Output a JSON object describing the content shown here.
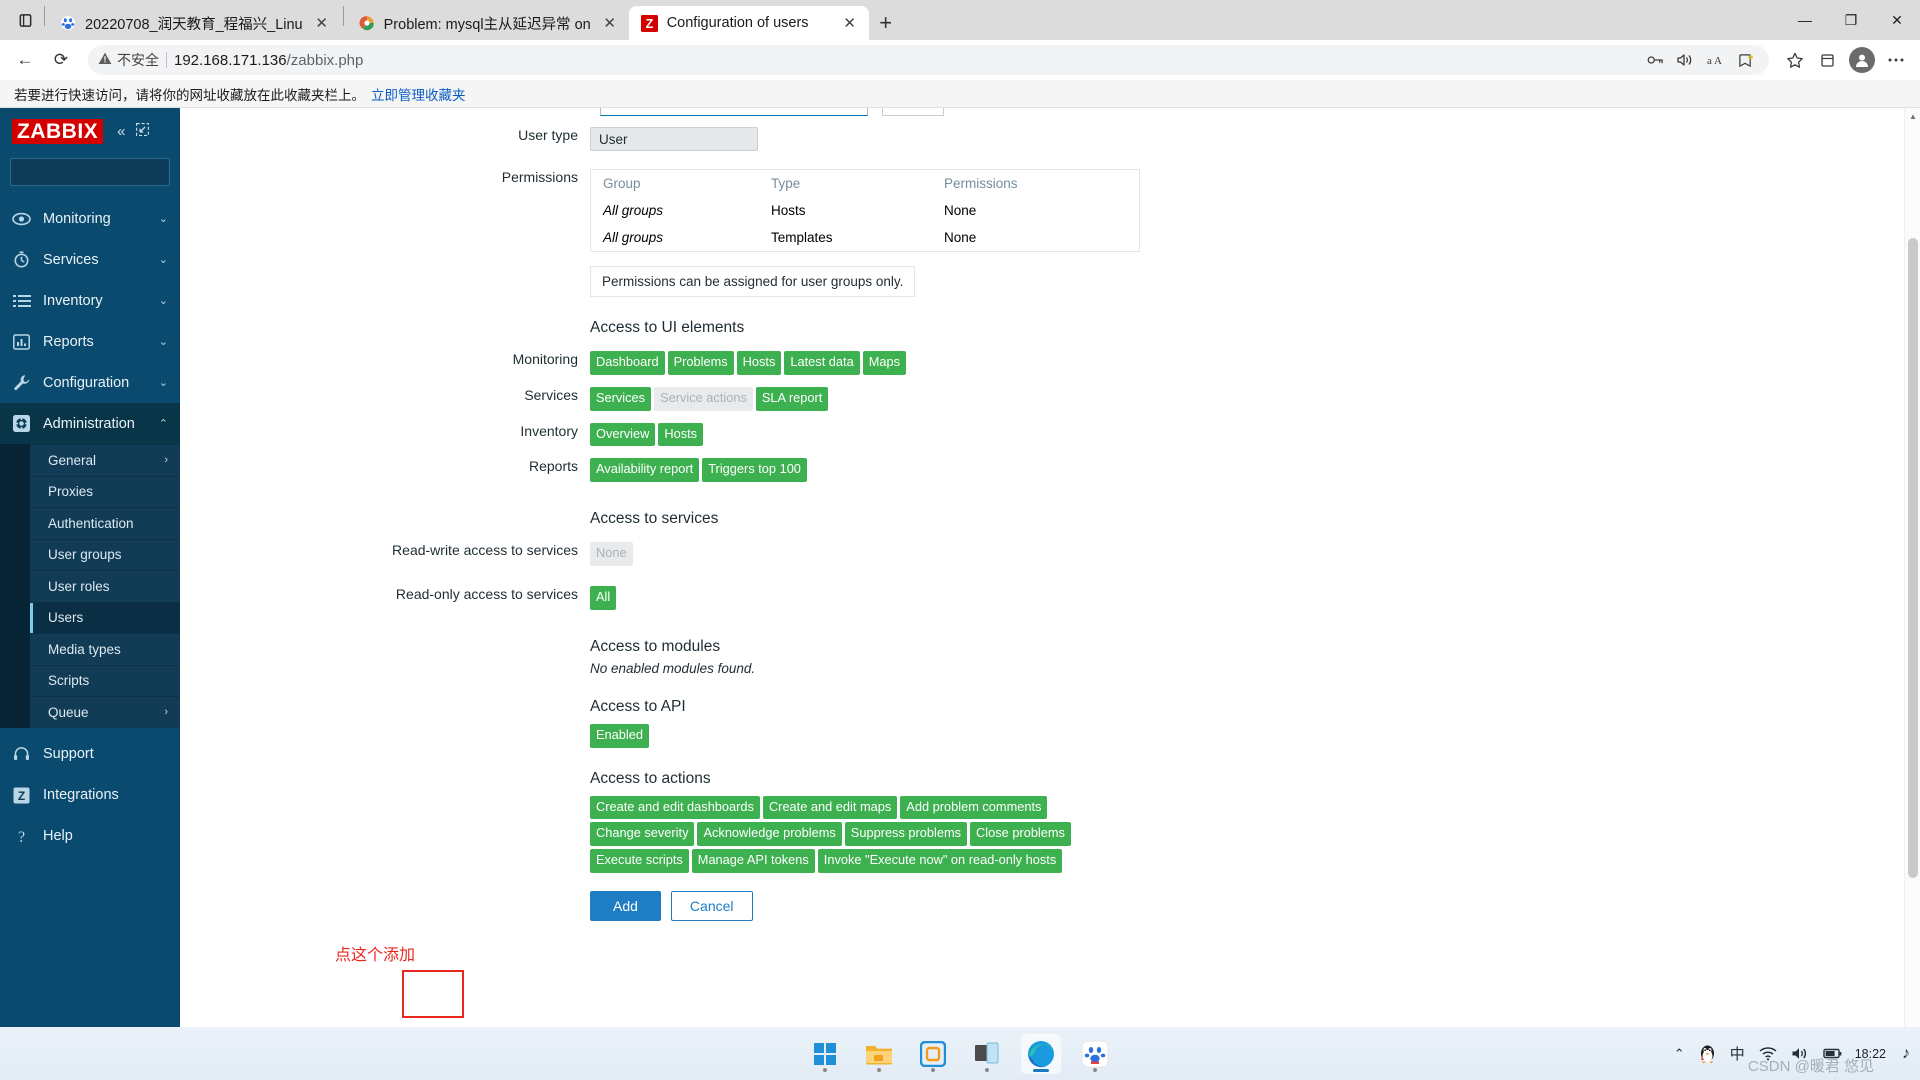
{
  "browser": {
    "tabs": [
      {
        "title": "20220708_润天教育_程福兴_Linu",
        "favicon": "baidu-icon",
        "active": false,
        "close_label": "✕"
      },
      {
        "title": "Problem: mysql主从延迟异常 on",
        "favicon": "zabbix-problem-icon",
        "active": false,
        "close_label": "✕"
      },
      {
        "title": "Configuration of users",
        "favicon": "zabbix-icon",
        "active": true,
        "close_label": "✕"
      }
    ],
    "new_tab_label": "+",
    "window_controls": {
      "minimize": "—",
      "maximize": "❐",
      "close": "✕"
    },
    "nav": {
      "back": "←",
      "reload": "⟳"
    },
    "omnibox": {
      "security_label": "不安全",
      "url_host": "192.168.171.136",
      "url_path": "/zabbix.php",
      "icons": [
        "key-icon",
        "read-aloud-icon",
        "translate-icon",
        "collections-add-icon"
      ]
    },
    "nav_right": {
      "favorites": "favorites-icon",
      "collections": "collections-icon",
      "profile": "avatar-icon",
      "settings": "more-settings-icon"
    },
    "bookmark_bar": {
      "text": "若要进行快速访问，请将你的网址收藏放在此收藏夹栏上。",
      "link": "立即管理收藏夹"
    }
  },
  "sidebar": {
    "logo": "ZABBIX",
    "collapse_icon": "«",
    "expand_icon": "⇱",
    "search_placeholder": "",
    "search_value": "",
    "items": [
      {
        "label": "Monitoring",
        "icon": "eye-icon",
        "chevron": "⌄",
        "active": false
      },
      {
        "label": "Services",
        "icon": "stopwatch-icon",
        "chevron": "⌄",
        "active": false
      },
      {
        "label": "Inventory",
        "icon": "list-icon",
        "chevron": "⌄",
        "active": false
      },
      {
        "label": "Reports",
        "icon": "bar-chart-icon",
        "chevron": "⌄",
        "active": false
      },
      {
        "label": "Configuration",
        "icon": "wrench-icon",
        "chevron": "⌄",
        "active": false
      },
      {
        "label": "Administration",
        "icon": "gear-icon",
        "chevron": "⌃",
        "active": true
      }
    ],
    "submenu": [
      {
        "label": "General",
        "arrow": "›",
        "selected": false
      },
      {
        "label": "Proxies",
        "arrow": "",
        "selected": false
      },
      {
        "label": "Authentication",
        "arrow": "",
        "selected": false
      },
      {
        "label": "User groups",
        "arrow": "",
        "selected": false
      },
      {
        "label": "User roles",
        "arrow": "",
        "selected": false
      },
      {
        "label": "Users",
        "arrow": "",
        "selected": true
      },
      {
        "label": "Media types",
        "arrow": "",
        "selected": false
      },
      {
        "label": "Scripts",
        "arrow": "",
        "selected": false
      },
      {
        "label": "Queue",
        "arrow": "›",
        "selected": false
      }
    ],
    "bottom_items": [
      {
        "label": "Support",
        "icon": "headset-icon"
      },
      {
        "label": "Integrations",
        "icon": "zabbix-z-icon"
      },
      {
        "label": "Help",
        "icon": "question-icon"
      }
    ]
  },
  "form": {
    "user_type": {
      "label": "User type",
      "value": "User"
    },
    "permissions": {
      "label": "Permissions",
      "headers": [
        "Group",
        "Type",
        "Permissions"
      ],
      "rows": [
        {
          "group": "All groups",
          "type": "Hosts",
          "permission": "None"
        },
        {
          "group": "All groups",
          "type": "Templates",
          "permission": "None"
        }
      ],
      "note": "Permissions can be assigned for user groups only."
    },
    "ui_elements": {
      "title": "Access to UI elements",
      "groups": [
        {
          "label": "Monitoring",
          "badges": [
            {
              "text": "Dashboard",
              "enabled": true
            },
            {
              "text": "Problems",
              "enabled": true
            },
            {
              "text": "Hosts",
              "enabled": true
            },
            {
              "text": "Latest data",
              "enabled": true
            },
            {
              "text": "Maps",
              "enabled": true
            }
          ]
        },
        {
          "label": "Services",
          "badges": [
            {
              "text": "Services",
              "enabled": true
            },
            {
              "text": "Service actions",
              "enabled": false
            },
            {
              "text": "SLA report",
              "enabled": true
            }
          ]
        },
        {
          "label": "Inventory",
          "badges": [
            {
              "text": "Overview",
              "enabled": true
            },
            {
              "text": "Hosts",
              "enabled": true
            }
          ]
        },
        {
          "label": "Reports",
          "badges": [
            {
              "text": "Availability report",
              "enabled": true
            },
            {
              "text": "Triggers top 100",
              "enabled": true
            }
          ]
        }
      ]
    },
    "services_access": {
      "title": "Access to services",
      "read_write": {
        "label": "Read-write access to services",
        "badge": {
          "text": "None",
          "enabled": false
        }
      },
      "read_only": {
        "label": "Read-only access to services",
        "badge": {
          "text": "All",
          "enabled": true
        }
      }
    },
    "modules": {
      "title": "Access to modules",
      "empty_text": "No enabled modules found."
    },
    "api": {
      "title": "Access to API",
      "badge": {
        "text": "Enabled",
        "enabled": true
      }
    },
    "actions": {
      "title": "Access to actions",
      "badges": [
        {
          "text": "Create and edit dashboards",
          "enabled": true
        },
        {
          "text": "Create and edit maps",
          "enabled": true
        },
        {
          "text": "Add problem comments",
          "enabled": true
        },
        {
          "text": "Change severity",
          "enabled": true
        },
        {
          "text": "Acknowledge problems",
          "enabled": true
        },
        {
          "text": "Suppress problems",
          "enabled": true
        },
        {
          "text": "Close problems",
          "enabled": true
        },
        {
          "text": "Execute scripts",
          "enabled": true
        },
        {
          "text": "Manage API tokens",
          "enabled": true
        },
        {
          "text": "Invoke \"Execute now\" on read-only hosts",
          "enabled": true
        }
      ]
    },
    "buttons": {
      "add": "Add",
      "cancel": "Cancel"
    }
  },
  "annotation": {
    "text": "点这个添加",
    "color": "#e8271f"
  },
  "taskbar": {
    "icons": [
      "start-icon",
      "file-explorer-icon",
      "app-icon",
      "device-icon",
      "edge-icon",
      "baidu-netdisk-icon"
    ],
    "tray": {
      "chevron": "⌃",
      "items": [
        "qq-penguin-icon",
        "ime-chinese-icon",
        "wifi-icon",
        "volume-icon",
        "battery-icon"
      ],
      "ime_label": "中",
      "time": "18:22",
      "notification": "♪"
    },
    "watermark": "CSDN @暖君 悠见"
  }
}
